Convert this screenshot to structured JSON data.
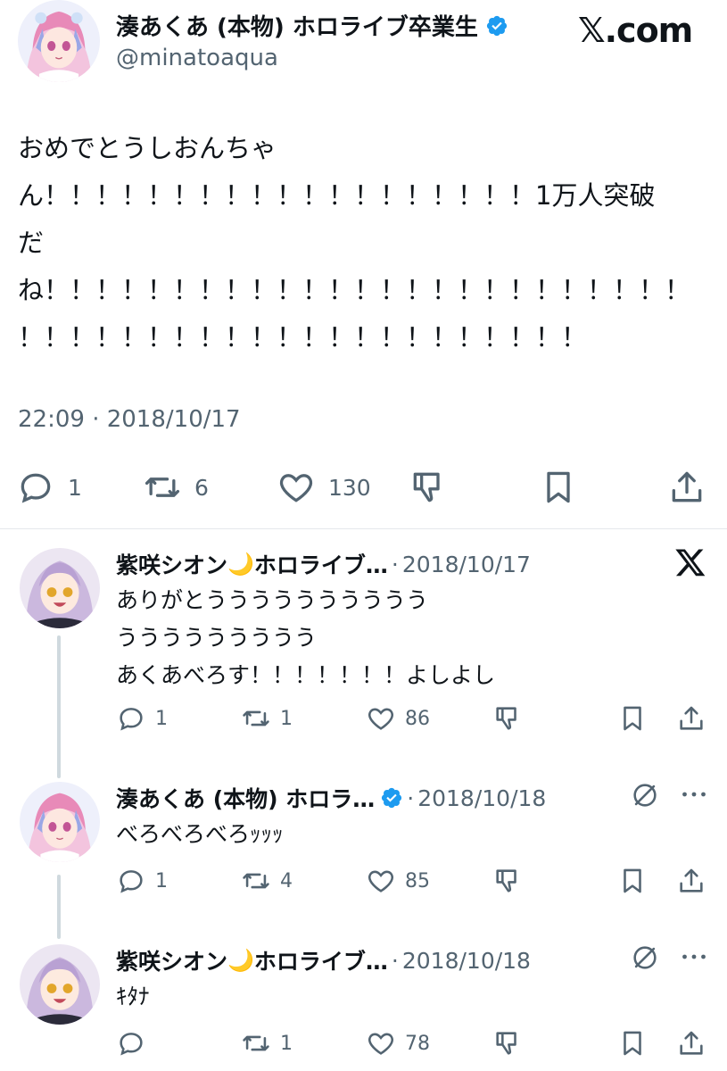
{
  "main_tweet": {
    "display_name": "湊あくあ (本物) ホロライブ卒業生",
    "handle": "@minatoaqua",
    "brand": "𝕏.com",
    "text": "おめでとうしおんちゃ\nん！！！！！！！！！！！！！！！！！！！1万人突破\nだ\nね！！！！！！！！！！！！！！！！！！！！！！！！！\n！！！！！！！！！！！！！！！！！！！！！！",
    "timestamp": "22:09 · 2018/10/17",
    "replies_count": "1",
    "retweets_count": "6",
    "likes_count": "130"
  },
  "replies": [
    {
      "display_name": "紫咲シオン",
      "moon": "🌙",
      "suffix": " ホロライブ…",
      "separator": "·",
      "date": "2018/10/17",
      "text": "ありがとうううううううううう\nううううううううう\nあくあべろす！！！！！！！よしよし",
      "replies_count": "1",
      "retweets_count": "1",
      "likes_count": "86"
    },
    {
      "display_name": "湊あくあ (本物) ホロラ…",
      "separator": "·",
      "date": "2018/10/18",
      "text": "べろべろべろｯｯｯ",
      "replies_count": "1",
      "retweets_count": "4",
      "likes_count": "85"
    },
    {
      "display_name": "紫咲シオン",
      "moon": "🌙",
      "suffix": " ホロライブ…",
      "separator": "·",
      "date": "2018/10/18",
      "text": "ｷﾀﾅ",
      "replies_count": "",
      "retweets_count": "1",
      "likes_count": "78"
    }
  ],
  "icons": {
    "reply": "reply-icon",
    "retweet": "retweet-icon",
    "like": "heart-icon",
    "dislike": "dislike-icon",
    "bookmark": "bookmark-icon",
    "share": "share-icon",
    "verified": "verified-badge-icon",
    "x_logo": "x-logo-icon",
    "more": "more-icon",
    "grok": "grok-icon"
  },
  "colors": {
    "text": "#0f1419",
    "muted": "#536471",
    "verified": "#1d9bf0",
    "thread_line": "#cfd9de"
  }
}
